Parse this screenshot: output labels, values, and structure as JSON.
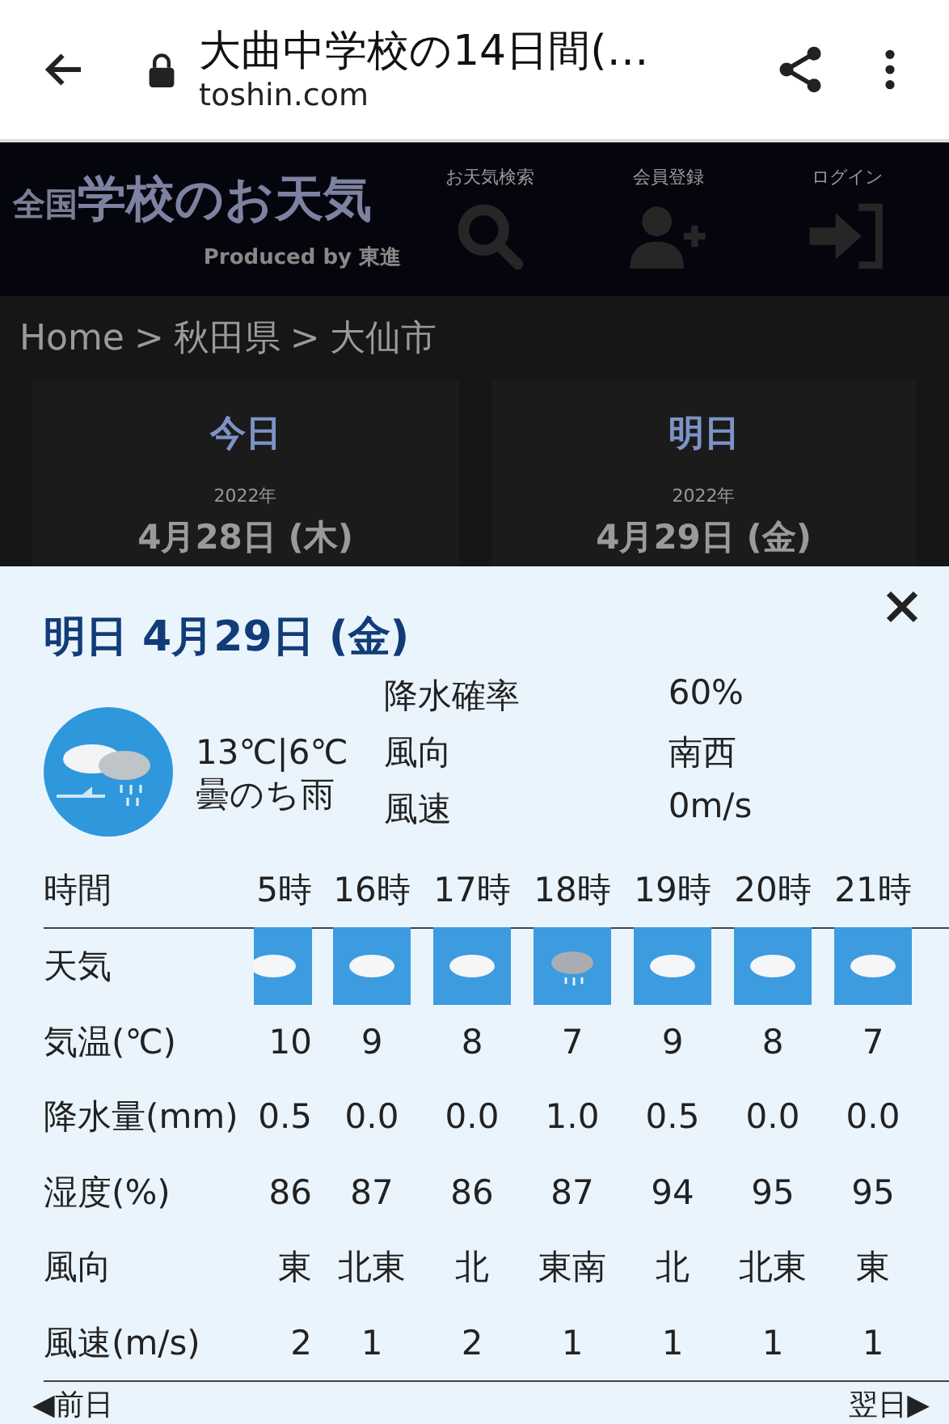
{
  "browser": {
    "title": "大曲中学校の14日間(…",
    "domain": "toshin.com"
  },
  "site_header": {
    "logo": {
      "title_small": "全国",
      "title": "学校のお天気",
      "subtitle": "Produced by 東進"
    },
    "nav": [
      {
        "label": "お天気検索",
        "kind": "search"
      },
      {
        "label": "会員登録",
        "kind": "register"
      },
      {
        "label": "ログイン",
        "kind": "login"
      }
    ]
  },
  "breadcrumb": {
    "separator": ">",
    "items": [
      "Home",
      "秋田県",
      "大仙市"
    ]
  },
  "day_cards": [
    {
      "label": "今日",
      "year": "2022年",
      "date": "4月28日 (木)"
    },
    {
      "label": "明日",
      "year": "2022年",
      "date": "4月29日 (金)"
    }
  ],
  "detail": {
    "title": "明日 4月29日 (金)",
    "temps": "13℃|6℃",
    "condition": "曇のち雨",
    "stats": [
      {
        "label": "降水確率",
        "value": "60%"
      },
      {
        "label": "風向",
        "value": "南西"
      },
      {
        "label": "風速",
        "value": "0m/s"
      }
    ],
    "table": {
      "header": {
        "label": "時間",
        "cells": [
          "5時",
          "16時",
          "17時",
          "18時",
          "19時",
          "20時",
          "21時"
        ]
      },
      "rows": [
        {
          "label": "天気",
          "kind": "icon",
          "cells": [
            {
              "kind": "cloudy"
            },
            {
              "kind": "cloudy"
            },
            {
              "kind": "cloudy"
            },
            {
              "kind": "rain"
            },
            {
              "kind": "cloudy"
            },
            {
              "kind": "cloudy"
            },
            {
              "kind": "cloudy"
            }
          ]
        },
        {
          "label": "気温(℃)",
          "kind": "text",
          "cells": [
            "10",
            "9",
            "8",
            "7",
            "9",
            "8",
            "7"
          ]
        },
        {
          "label": "降水量(mm)",
          "kind": "text",
          "cells": [
            "0.5",
            "0.0",
            "0.0",
            "1.0",
            "0.5",
            "0.0",
            "0.0"
          ]
        },
        {
          "label": "湿度(%)",
          "kind": "text",
          "cells": [
            "86",
            "87",
            "86",
            "87",
            "94",
            "95",
            "95"
          ]
        },
        {
          "label": "風向",
          "kind": "text",
          "cells": [
            "東",
            "北東",
            "北",
            "東南",
            "北",
            "北東",
            "東"
          ]
        },
        {
          "label": "風速(m/s)",
          "kind": "text",
          "cells": [
            "2",
            "1",
            "2",
            "1",
            "1",
            "1",
            "1"
          ]
        }
      ]
    },
    "prev": "◀前日",
    "next": "翌日▶"
  }
}
